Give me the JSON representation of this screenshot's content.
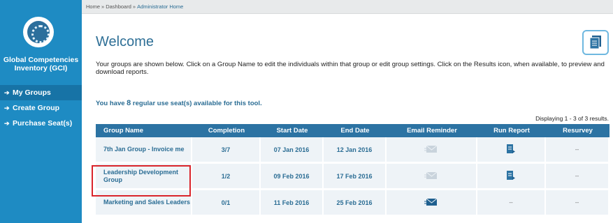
{
  "app": {
    "title": "Global Competencies Inventory (GCI)",
    "icon": "gci-logo-icon",
    "brand_color": "#1e8bc3"
  },
  "nav": {
    "items": [
      {
        "label": "My Groups",
        "icon": "arrow-right-icon",
        "active": true
      },
      {
        "label": "Create Group",
        "icon": "arrow-right-icon",
        "active": false
      },
      {
        "label": "Purchase Seat(s)",
        "icon": "arrow-right-icon",
        "active": false
      }
    ]
  },
  "breadcrumb": {
    "items": [
      "Home",
      "Dashboard",
      "Administrator Home"
    ],
    "separator": "»"
  },
  "main": {
    "title": "Welcome",
    "intro": "Your groups are shown below. Click on a Group Name to edit the individuals within that group or edit group settings. Click on the Results icon, when available, to preview and download reports.",
    "seats_prefix": "You have ",
    "seats_count": "8",
    "seats_suffix": " regular use seat(s) available for this tool.",
    "displaying": "Displaying 1 - 3 of 3 results."
  },
  "table": {
    "columns": [
      "Group Name",
      "Completion",
      "Start Date",
      "End Date",
      "Email Reminder",
      "Run Report",
      "Resurvey"
    ],
    "rows": [
      {
        "name": "7th Jan Group - Invoice me",
        "completion": "3/7",
        "start": "07 Jan 2016",
        "end": "12 Jan 2016",
        "email": "email-icon-disabled",
        "report": "report-icon",
        "resurvey": "--"
      },
      {
        "name": "Leadership Development Group",
        "completion": "1/2",
        "start": "09 Feb 2016",
        "end": "17 Feb 2016",
        "email": "email-icon-disabled",
        "report": "report-icon",
        "resurvey": "--"
      },
      {
        "name": "Marketing and Sales Leaders",
        "completion": "0/1",
        "start": "11 Feb 2016",
        "end": "25 Feb 2016",
        "email": "email-icon",
        "report": "--",
        "resurvey": "--"
      }
    ]
  },
  "colors": {
    "header": "#2c73a3",
    "row_bg": "#eef3f7",
    "link": "#2b6d94",
    "highlight": "#d9242b"
  }
}
